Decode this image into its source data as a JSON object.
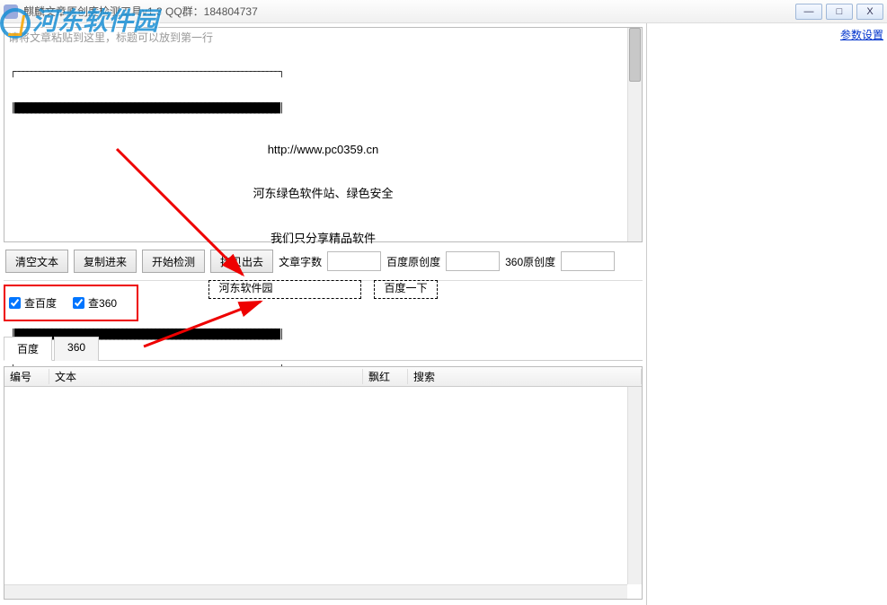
{
  "window": {
    "title": "麒麟文章原创度检测工具v1.3 QQ群：184804737",
    "minimize": "—",
    "maximize": "□",
    "close": "X"
  },
  "watermark_text": "河东软件园",
  "rightPanel": {
    "paramsLink": "参数设置"
  },
  "editor": {
    "placeholder": "请将文章粘贴到这里，标题可以放到第一行",
    "ascii": {
      "url": "http://www.pc0359.cn",
      "line1": "河东绿色软件站、绿色安全",
      "line2": "我们只分享精品软件",
      "box1": "河东软件园",
      "box2": "百度一下"
    }
  },
  "toolbar": {
    "clear": "清空文本",
    "copyIn": "复制进来",
    "start": "开始检测",
    "copyOut": "拷贝出去",
    "wordCountLabel": "文章字数",
    "baiduOrigLabel": "百度原创度",
    "s360OrigLabel": "360原创度",
    "wordCountValue": "",
    "baiduOrigValue": "",
    "s360OrigValue": ""
  },
  "checks": {
    "baidu": "查百度",
    "s360": "查360"
  },
  "tabs": {
    "baidu": "百度",
    "s360": "360"
  },
  "grid": {
    "col1": "编号",
    "col2": "文本",
    "col3": "飘红",
    "col4": "搜索"
  }
}
